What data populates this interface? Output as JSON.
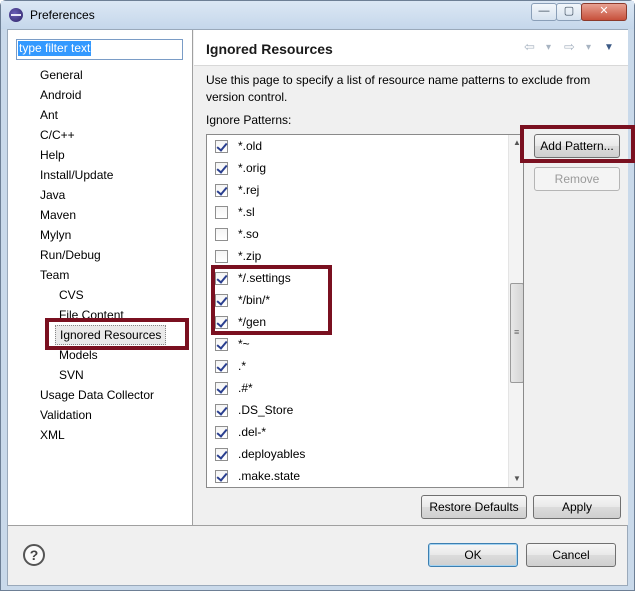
{
  "window": {
    "title": "Preferences",
    "minimize_glyph": "—",
    "maximize_glyph": "▢",
    "close_glyph": "✕"
  },
  "filter": {
    "value": "type filter text"
  },
  "tree": {
    "items": [
      {
        "label": "General",
        "indent": 0
      },
      {
        "label": "Android",
        "indent": 0
      },
      {
        "label": "Ant",
        "indent": 0
      },
      {
        "label": "C/C++",
        "indent": 0
      },
      {
        "label": "Help",
        "indent": 0
      },
      {
        "label": "Install/Update",
        "indent": 0
      },
      {
        "label": "Java",
        "indent": 0
      },
      {
        "label": "Maven",
        "indent": 0
      },
      {
        "label": "Mylyn",
        "indent": 0
      },
      {
        "label": "Run/Debug",
        "indent": 0
      },
      {
        "label": "Team",
        "indent": 0
      },
      {
        "label": "CVS",
        "indent": 1
      },
      {
        "label": "File Content",
        "indent": 1
      },
      {
        "label": "Ignored Resources",
        "indent": 1,
        "selected": true
      },
      {
        "label": "Models",
        "indent": 1
      },
      {
        "label": "SVN",
        "indent": 1
      },
      {
        "label": "Usage Data Collector",
        "indent": 0
      },
      {
        "label": "Validation",
        "indent": 0
      },
      {
        "label": "XML",
        "indent": 0
      }
    ]
  },
  "page": {
    "title": "Ignored Resources",
    "description": "Use this page to specify a list of resource name patterns to exclude from version control.",
    "patterns_label": "Ignore Patterns:",
    "patterns": [
      {
        "text": "*.old",
        "checked": true
      },
      {
        "text": "*.orig",
        "checked": true
      },
      {
        "text": "*.rej",
        "checked": true
      },
      {
        "text": "*.sl",
        "checked": false
      },
      {
        "text": "*.so",
        "checked": false
      },
      {
        "text": "*.zip",
        "checked": false
      },
      {
        "text": "*/.settings",
        "checked": true
      },
      {
        "text": "*/bin/*",
        "checked": true
      },
      {
        "text": "*/gen",
        "checked": true
      },
      {
        "text": "*~",
        "checked": true
      },
      {
        "text": ".*",
        "checked": true
      },
      {
        "text": ".#*",
        "checked": true
      },
      {
        "text": ".DS_Store",
        "checked": true
      },
      {
        "text": ".del-*",
        "checked": true
      },
      {
        "text": ".deployables",
        "checked": true
      },
      {
        "text": ".make.state",
        "checked": true
      }
    ],
    "add_pattern_label": "Add Pattern...",
    "remove_label": "Remove",
    "restore_defaults_label": "Restore Defaults",
    "apply_label": "Apply"
  },
  "nav": {
    "back_glyph": "⇦",
    "forward_glyph": "⇨",
    "dropdown_glyph": "▾",
    "menu_glyph": "▼"
  },
  "footer": {
    "help_glyph": "?",
    "ok_label": "OK",
    "cancel_label": "Cancel"
  },
  "scrollbar": {
    "up_glyph": "▲",
    "down_glyph": "▼",
    "grip_glyph": "≡"
  },
  "colors": {
    "highlight_border": "#7a1020",
    "selection": "#3399ff"
  }
}
